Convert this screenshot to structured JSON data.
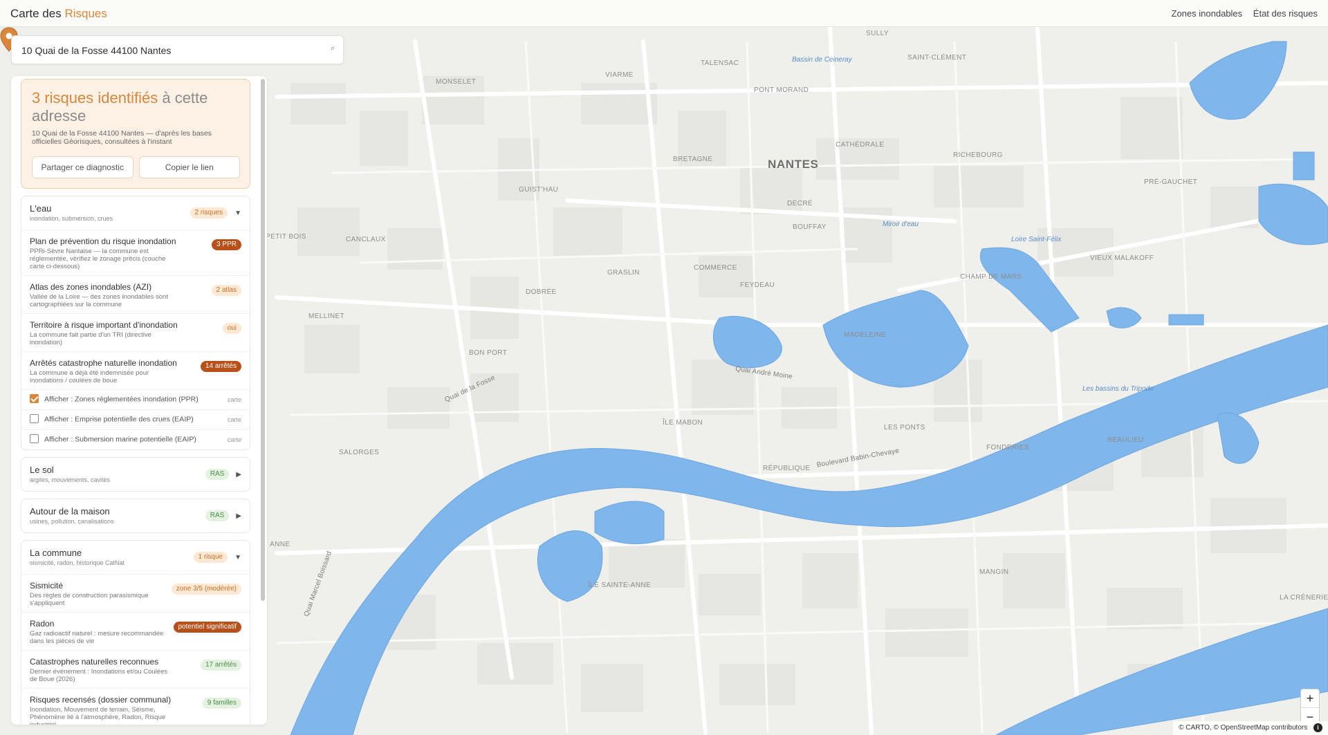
{
  "header": {
    "brand_prefix": "Carte des",
    "brand_accent": "Risques",
    "nav": [
      "Zones inondables",
      "État des risques"
    ]
  },
  "search": {
    "value": "10 Quai de la Fosse 44100 Nantes",
    "icon": "search-icon"
  },
  "summary": {
    "title_highlight": "3 risques identifiés",
    "title_rest": "à cette adresse",
    "subtitle": "10 Quai de la Fosse 44100 Nantes — d'après les bases officielles Géorisques, consultées à l'instant",
    "share_label": "Partager ce diagnostic",
    "copy_label": "Copier le lien"
  },
  "sections": {
    "eau": {
      "title": "L'eau",
      "subtitle": "inondation, submersion, crues",
      "badge": "2 risques",
      "items": [
        {
          "title": "Plan de prévention du risque inondation",
          "desc": "PPRi-Sèvre Nantaise — la commune est réglementée, vérifiez le zonage précis (couche carte ci-dessous)",
          "badge": "3 PPR"
        },
        {
          "title": "Atlas des zones inondables (AZI)",
          "desc": "Vallée de la Loire — des zones inondables sont cartographiées sur la commune",
          "badge": "2 atlas"
        },
        {
          "title": "Territoire à risque important d'inondation",
          "desc": "La commune fait partie d'un TRI (directive inondation)",
          "badge": "oui"
        },
        {
          "title": "Arrêtés catastrophe naturelle inondation",
          "desc": "La commune a déjà été indemnisée pour inondations / coulées de boue",
          "badge": "14 arrêtés"
        }
      ],
      "layers": [
        {
          "label": "Afficher : Zones réglementées inondation (PPR)",
          "tag": "carte",
          "checked": true
        },
        {
          "label": "Afficher : Emprise potentielle des crues (EAIP)",
          "tag": "carte",
          "checked": false
        },
        {
          "label": "Afficher : Submersion marine potentielle (EAIP)",
          "tag": "carte",
          "checked": false
        }
      ]
    },
    "sol": {
      "title": "Le sol",
      "subtitle": "argiles, mouvements, cavités",
      "badge": "RAS"
    },
    "maison": {
      "title": "Autour de la maison",
      "subtitle": "usines, pollution, canalisations",
      "badge": "RAS"
    },
    "commune": {
      "title": "La commune",
      "subtitle": "sismicité, radon, historique CatNat",
      "badge": "1 risque",
      "items": [
        {
          "title": "Sismicité",
          "desc": "Des règles de construction parasismique s'appliquent",
          "badge": "zone 3/5 (modérée)"
        },
        {
          "title": "Radon",
          "desc": "Gaz radioactif naturel : mesure recommandée dans les pièces de vie",
          "badge": "potentiel significatif"
        },
        {
          "title": "Catastrophes naturelles reconnues",
          "desc": "Dernier événement : Inondations et/ou Coulées de Boue (2026)",
          "badge": "17 arrêtés"
        },
        {
          "title": "Risques recensés (dossier communal)",
          "desc": "Inondation, Mouvement de terrain, Séisme, Phénomène lié à l'atmosphère, Radon, Risque industriel",
          "badge": "9 familles"
        }
      ]
    }
  },
  "map": {
    "labels": {
      "nantes": "NANTES",
      "sully": "SULLY",
      "saint_clement": "SAINT-CLÉMENT",
      "viarme": "VIARME",
      "talensac": "TALENSAC",
      "monselet": "MONSELET",
      "pont_morand": "PONT MORAND",
      "bassin_ceineray": "Bassin de Ceineray",
      "cathedrale": "CATHÉDRALE",
      "richebourg": "RICHEBOURG",
      "bretagne": "BRETAGNE",
      "guisthau": "GUIST'HAU",
      "pre_gauchet": "PRÉ-GAUCHET",
      "decre": "DECRÉ",
      "bouffay": "BOUFFAY",
      "canclaux": "CANCLAUX",
      "petit_bois": "PETIT BOIS",
      "miroir_eau": "Miroir d'eau",
      "loire_saint_felix": "Loire Saint-Félix",
      "vieux_malakoff": "VIEUX MALAKOFF",
      "graslin": "GRASLIN",
      "commerce": "COMMERCE",
      "feydeau": "FEYDEAU",
      "champ_de_mars": "CHAMP DE MARS",
      "dobree": "DOBRÉE",
      "melunet": "MELLINET",
      "madeleine": "MADELEINE",
      "bon_port": "BON PORT",
      "quai_fosse": "Quai de la Fosse",
      "quai_moncousu": "Quai André Moine",
      "bassins_tripode": "Les bassins du Tripode",
      "ile_mabon": "ÎLE MABON",
      "les_ponts": "LES PONTS",
      "salorges": "SALORGES",
      "republique": "RÉPUBLIQUE",
      "bd_babin": "Boulevard Babin-Chevaye",
      "fonderies": "FONDERIES",
      "beaulieu": "BEAULIEU",
      "sainte_anne": "SAINTE-ANNE",
      "quai_aiguillon": "Quai Marcel Boissard",
      "ile_sainte_anne": "ÎLE SAINTE-ANNE",
      "mangin": "MANGIN",
      "la_crenerie": "LA CRÉNERIE",
      "anne": "ANNE"
    },
    "marker": "map-pin-icon",
    "zoom_in": "+",
    "zoom_out": "−",
    "attribution": "© CARTO, © OpenStreetMap contributors",
    "attribution_info": "i"
  },
  "colors": {
    "accent": "#d9873a",
    "water": "#7fb6ec",
    "badge_dark": "#b8501a",
    "badge_green": "#4d8a44"
  }
}
